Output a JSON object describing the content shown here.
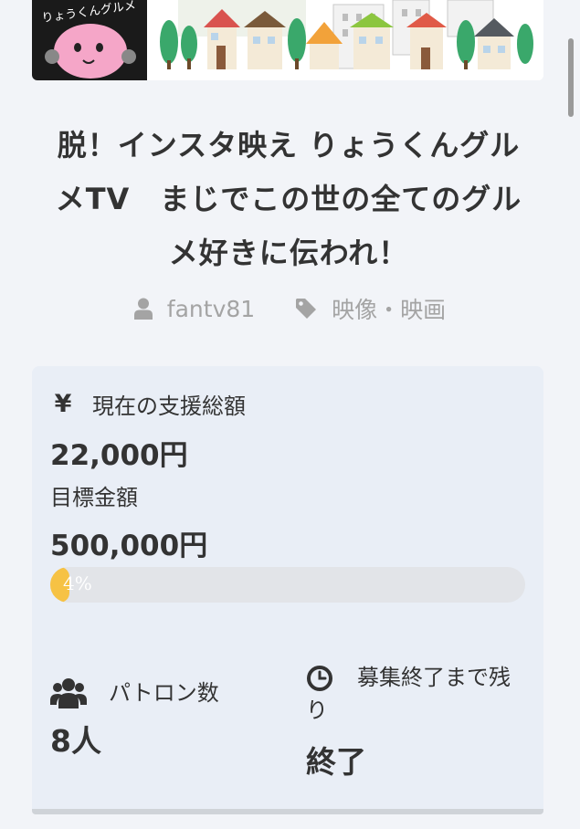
{
  "banner": {
    "mascot_text": "りょうくんグルメ"
  },
  "project": {
    "title_line1": "脱！インスタ映え りょうくんグル",
    "title_line2": "メTV　まじでこの世の全てのグル",
    "title_line3": "メ好きに伝われ！",
    "author": "fantv81",
    "category": "映像・映画"
  },
  "funding": {
    "current_label": "現在の支援総額",
    "current_icon": "yen-icon",
    "current_amount": "22,000円",
    "goal_label": "目標金額",
    "goal_amount": "500,000円",
    "progress_percent": 4,
    "progress_text": "4%",
    "accent_color": "#f6c244"
  },
  "stats": {
    "patrons_label": "パトロン数",
    "patrons_value": "8人",
    "remaining_label": "募集終了まで残り",
    "remaining_value": "終了"
  },
  "icons": {
    "author": "user-icon",
    "category": "tag-icon",
    "patrons": "users-icon",
    "remaining": "clock-icon"
  }
}
